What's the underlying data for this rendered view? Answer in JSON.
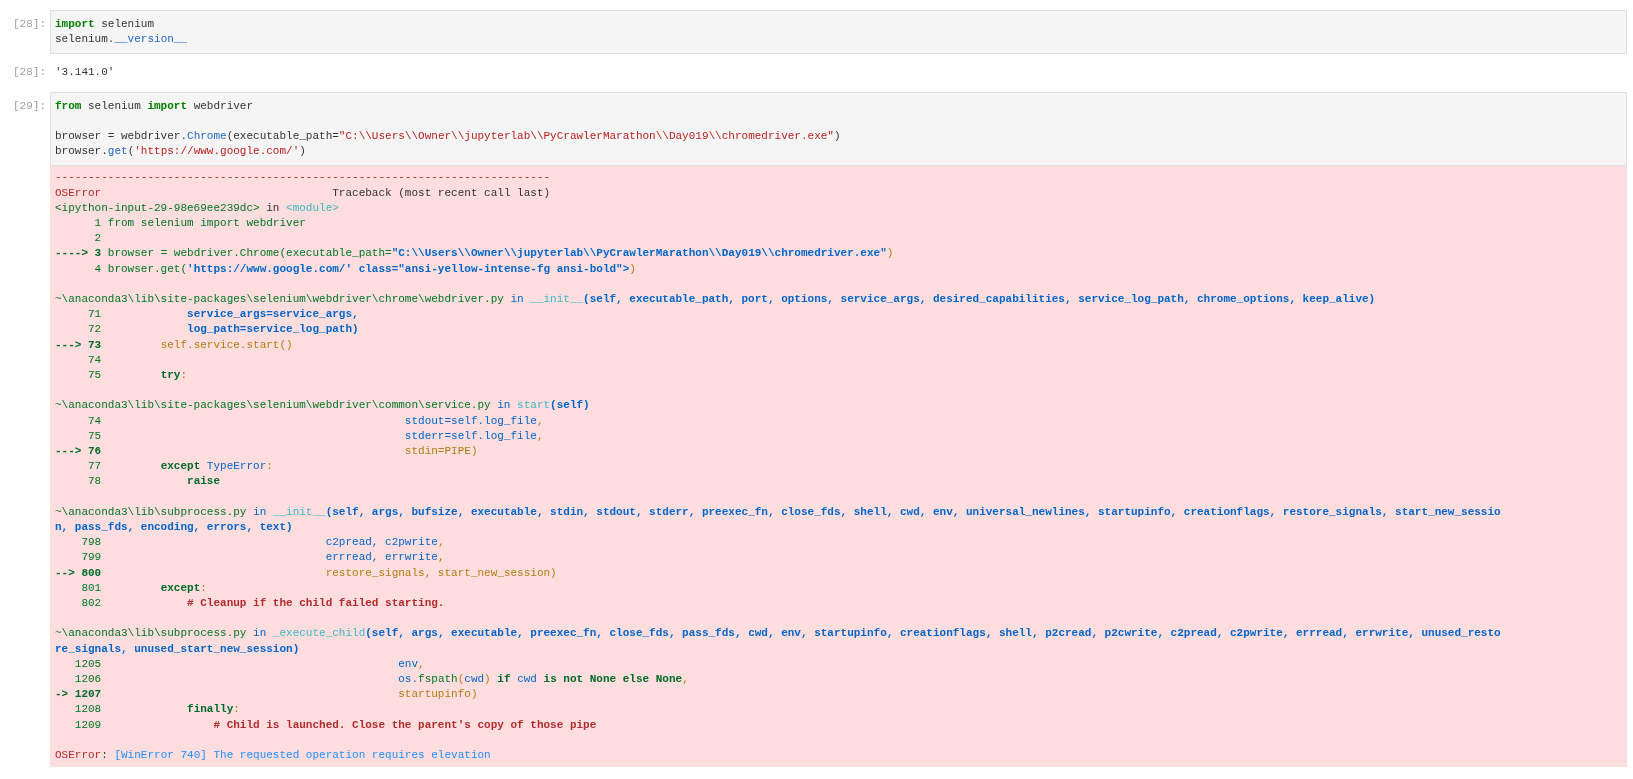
{
  "cells": [
    {
      "kind": "input",
      "prompt": "[28]:",
      "blocks": [
        {
          "lines": [
            {
              "segments": [
                {
                  "kind": "kw",
                  "text": "import"
                },
                {
                  "kind": "plain",
                  "text": " selenium"
                }
              ]
            },
            {
              "segments": [
                {
                  "kind": "plain",
                  "text": "selenium."
                },
                {
                  "kind": "attr",
                  "text": "__version__"
                }
              ]
            }
          ]
        }
      ]
    },
    {
      "kind": "output",
      "prompt": "[28]:",
      "blocks": [
        {
          "lines": [
            {
              "segments": [
                {
                  "kind": "plain",
                  "text": "'3.141.0'"
                }
              ]
            }
          ]
        }
      ]
    },
    {
      "kind": "input",
      "prompt": "[29]:",
      "blocks": [
        {
          "lines": [
            {
              "segments": [
                {
                  "kind": "kw",
                  "text": "from"
                },
                {
                  "kind": "plain",
                  "text": " selenium "
                },
                {
                  "kind": "kw",
                  "text": "import"
                },
                {
                  "kind": "plain",
                  "text": " webdriver"
                }
              ]
            }
          ]
        },
        {
          "lines": [
            {
              "segments": [
                {
                  "kind": "plain",
                  "text": "browser = webdriver."
                },
                {
                  "kind": "attr",
                  "text": "Chrome"
                },
                {
                  "kind": "plain",
                  "text": "(executable_path="
                },
                {
                  "kind": "str",
                  "text": "\"C:\\\\Users\\\\Owner\\\\jupyterlab\\\\PyCrawlerMarathon\\\\Day019\\\\chromedriver.exe\""
                },
                {
                  "kind": "plain",
                  "text": ")"
                }
              ]
            },
            {
              "segments": [
                {
                  "kind": "plain",
                  "text": "browser."
                },
                {
                  "kind": "attr",
                  "text": "get"
                },
                {
                  "kind": "plain",
                  "text": "("
                },
                {
                  "kind": "str",
                  "text": "'https://www.google.com/'"
                },
                {
                  "kind": "plain",
                  "text": ")"
                }
              ]
            }
          ]
        }
      ]
    },
    {
      "kind": "error",
      "blocks": [
        {
          "lines": [
            {
              "segments": [
                {
                  "kind": "red",
                  "text": "---------------------------------------------------------------------------"
                }
              ]
            },
            {
              "segments": [
                {
                  "kind": "red",
                  "text": "OSError"
                },
                {
                  "kind": "plain",
                  "text": "                                   Traceback (most recent call last)"
                }
              ]
            },
            {
              "segments": [
                {
                  "kind": "green",
                  "text": "<ipython-input-29-98e69ee239dc>"
                },
                {
                  "kind": "plain",
                  "text": " in "
                },
                {
                  "kind": "cyan",
                  "text": "<module>"
                }
              ]
            },
            {
              "segments": [
                {
                  "kind": "green",
                  "text": "      1 from selenium import webdriver"
                }
              ]
            },
            {
              "segments": [
                {
                  "kind": "green",
                  "text": "      2"
                }
              ]
            },
            {
              "segments": [
                {
                  "kind": "greenb",
                  "text": "----> 3"
                },
                {
                  "kind": "green",
                  "text": " browser = webdriver.Chrome(executable_path="
                },
                {
                  "kind": "blue",
                  "text": "\"C:\\\\Users\\\\Owner\\\\jupyterlab\\\\PyCrawlerMarathon\\\\Day019\\\\chromedriver.exe\""
                },
                {
                  "kind": "yellow",
                  "text": ")"
                }
              ]
            },
            {
              "segments": [
                {
                  "kind": "green",
                  "text": "      4 browser.get("
                },
                {
                  "kind": "blue",
                  "text": "'https://www.google.com/' class=\"ansi-yellow-intense-fg ansi-bold\">"
                },
                {
                  "kind": "yellow",
                  "text": ")"
                }
              ]
            }
          ]
        },
        {
          "lines": [
            {
              "segments": [
                {
                  "kind": "green",
                  "text": "~\\anaconda3\\lib\\site-packages\\selenium\\webdriver\\chrome\\webdriver.py"
                },
                {
                  "kind": "bluep",
                  "text": " in "
                },
                {
                  "kind": "cyan",
                  "text": "__init__"
                },
                {
                  "kind": "blue",
                  "text": "(self, executable_path, port, options, service_args, desired_capabilities, service_log_path, chrome_options, keep_alive)"
                }
              ]
            },
            {
              "segments": [
                {
                  "kind": "green",
                  "text": "     71"
                },
                {
                  "kind": "blue",
                  "text": "             service_args=service_args,"
                }
              ]
            },
            {
              "segments": [
                {
                  "kind": "green",
                  "text": "     72"
                },
                {
                  "kind": "blue",
                  "text": "             log_path=service_log_path)"
                }
              ]
            },
            {
              "segments": [
                {
                  "kind": "greenb",
                  "text": "---> 73"
                },
                {
                  "kind": "yellow",
                  "text": "         self.service.start()"
                }
              ]
            },
            {
              "segments": [
                {
                  "kind": "green",
                  "text": "     74"
                }
              ]
            },
            {
              "segments": [
                {
                  "kind": "green",
                  "text": "     75"
                },
                {
                  "kind": "greenb",
                  "text": "         try"
                },
                {
                  "kind": "yellow",
                  "text": ":"
                }
              ]
            }
          ]
        },
        {
          "lines": [
            {
              "segments": [
                {
                  "kind": "green",
                  "text": "~\\anaconda3\\lib\\site-packages\\selenium\\webdriver\\common\\service.py"
                },
                {
                  "kind": "bluep",
                  "text": " in "
                },
                {
                  "kind": "cyan",
                  "text": "start"
                },
                {
                  "kind": "blue",
                  "text": "(self)"
                }
              ]
            },
            {
              "segments": [
                {
                  "kind": "green",
                  "text": "     74"
                },
                {
                  "kind": "bluep",
                  "text": "                                              stdout=self.log_file"
                },
                {
                  "kind": "yellow",
                  "text": ","
                }
              ]
            },
            {
              "segments": [
                {
                  "kind": "green",
                  "text": "     75"
                },
                {
                  "kind": "bluep",
                  "text": "                                              stderr=self.log_file"
                },
                {
                  "kind": "yellow",
                  "text": ","
                }
              ]
            },
            {
              "segments": [
                {
                  "kind": "greenb",
                  "text": "---> 76"
                },
                {
                  "kind": "yellow",
                  "text": "                                              stdin=PIPE)"
                }
              ]
            },
            {
              "segments": [
                {
                  "kind": "green",
                  "text": "     77"
                },
                {
                  "kind": "greenb",
                  "text": "         except"
                },
                {
                  "kind": "bluep",
                  "text": " TypeError"
                },
                {
                  "kind": "yellow",
                  "text": ":"
                }
              ]
            },
            {
              "segments": [
                {
                  "kind": "green",
                  "text": "     78"
                },
                {
                  "kind": "greenb",
                  "text": "             raise"
                }
              ]
            }
          ]
        },
        {
          "lines": [
            {
              "segments": [
                {
                  "kind": "green",
                  "text": "~\\anaconda3\\lib\\subprocess.py"
                },
                {
                  "kind": "bluep",
                  "text": " in "
                },
                {
                  "kind": "cyan",
                  "text": "__init__"
                },
                {
                  "kind": "blue",
                  "text": "(self, args, bufsize, executable, stdin, stdout, stderr, preexec_fn, close_fds, shell, cwd, env, universal_newlines, startupinfo, creationflags, restore_signals, start_new_sessio"
                }
              ]
            },
            {
              "segments": [
                {
                  "kind": "blue",
                  "text": "n, pass_fds, encoding, errors, text)"
                }
              ]
            },
            {
              "segments": [
                {
                  "kind": "green",
                  "text": "    798"
                },
                {
                  "kind": "bluep",
                  "text": "                                  c2pread, c2pwrite"
                },
                {
                  "kind": "yellow",
                  "text": ","
                }
              ]
            },
            {
              "segments": [
                {
                  "kind": "green",
                  "text": "    799"
                },
                {
                  "kind": "bluep",
                  "text": "                                  errread, errwrite"
                },
                {
                  "kind": "yellow",
                  "text": ","
                }
              ]
            },
            {
              "segments": [
                {
                  "kind": "greenb",
                  "text": "--> 800"
                },
                {
                  "kind": "yellow",
                  "text": "                                  restore_signals, start_new_session)"
                }
              ]
            },
            {
              "segments": [
                {
                  "kind": "green",
                  "text": "    801"
                },
                {
                  "kind": "greenb",
                  "text": "         except"
                },
                {
                  "kind": "yellow",
                  "text": ":"
                }
              ]
            },
            {
              "segments": [
                {
                  "kind": "green",
                  "text": "    802"
                },
                {
                  "kind": "redb",
                  "text": "             # Cleanup if the child failed starting."
                }
              ]
            }
          ]
        },
        {
          "lines": [
            {
              "segments": [
                {
                  "kind": "green",
                  "text": "~\\anaconda3\\lib\\subprocess.py"
                },
                {
                  "kind": "bluep",
                  "text": " in "
                },
                {
                  "kind": "cyan",
                  "text": "_execute_child"
                },
                {
                  "kind": "blue",
                  "text": "(self, args, executable, preexec_fn, close_fds, pass_fds, cwd, env, startupinfo, creationflags, shell, p2cread, p2cwrite, c2pread, c2pwrite, errread, errwrite, unused_resto"
                }
              ]
            },
            {
              "segments": [
                {
                  "kind": "blue",
                  "text": "re_signals, unused_start_new_session)"
                }
              ]
            },
            {
              "segments": [
                {
                  "kind": "green",
                  "text": "   1205"
                },
                {
                  "kind": "bluep",
                  "text": "                                             env"
                },
                {
                  "kind": "yellow",
                  "text": ","
                }
              ]
            },
            {
              "segments": [
                {
                  "kind": "green",
                  "text": "   1206"
                },
                {
                  "kind": "bluep",
                  "text": "                                             os."
                },
                {
                  "kind": "green",
                  "text": "fspath"
                },
                {
                  "kind": "yellow",
                  "text": "("
                },
                {
                  "kind": "bluep",
                  "text": "cwd"
                },
                {
                  "kind": "yellow",
                  "text": ")"
                },
                {
                  "kind": "greenb",
                  "text": " if"
                },
                {
                  "kind": "bluep",
                  "text": " cwd"
                },
                {
                  "kind": "greenb",
                  "text": " is not None else None"
                },
                {
                  "kind": "yellow",
                  "text": ","
                }
              ]
            },
            {
              "segments": [
                {
                  "kind": "greenb",
                  "text": "-> 1207"
                },
                {
                  "kind": "yellow",
                  "text": "                                             startupinfo)"
                }
              ]
            },
            {
              "segments": [
                {
                  "kind": "green",
                  "text": "   1208"
                },
                {
                  "kind": "greenb",
                  "text": "             finally"
                },
                {
                  "kind": "yellow",
                  "text": ":"
                }
              ]
            },
            {
              "segments": [
                {
                  "kind": "green",
                  "text": "   1209"
                },
                {
                  "kind": "redb",
                  "text": "                 # Child is launched. Close the parent's copy of those pipe"
                }
              ]
            }
          ]
        },
        {
          "lines": [
            {
              "segments": [
                {
                  "kind": "red",
                  "text": "OSError"
                },
                {
                  "kind": "plain",
                  "text": ": "
                },
                {
                  "kind": "lightblue",
                  "text": "[WinError 740] The requested operation requires elevation"
                }
              ]
            }
          ]
        }
      ]
    }
  ]
}
